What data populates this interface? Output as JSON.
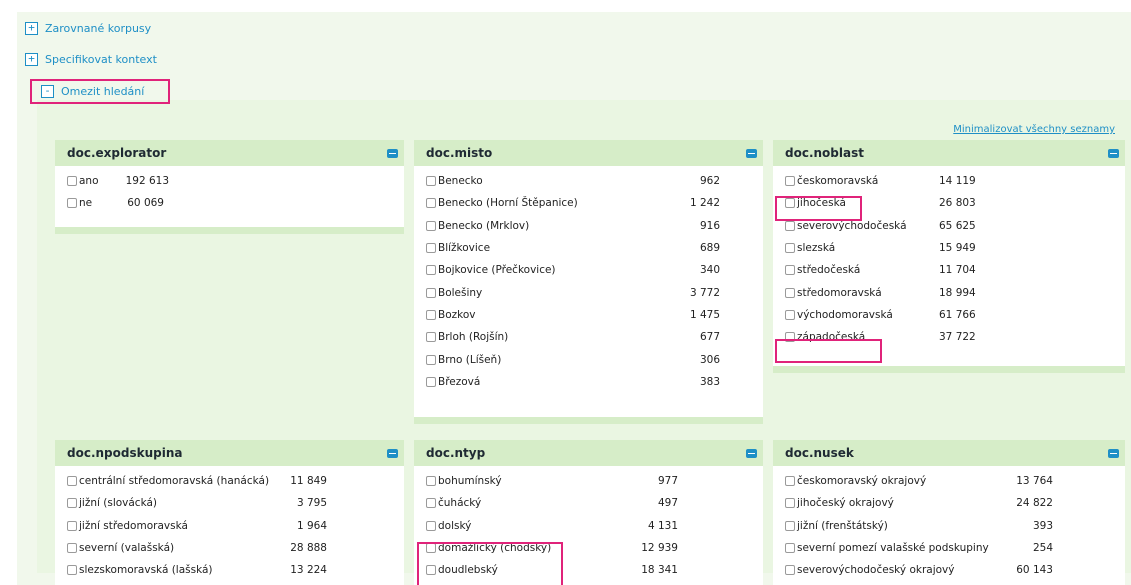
{
  "toggles": [
    {
      "symbol": "+",
      "label": "Zarovnané korpusy"
    },
    {
      "symbol": "+",
      "label": "Specifikovat kontext"
    },
    {
      "symbol": "-",
      "label": "Omezit hledání"
    }
  ],
  "minimize_all_label": "Minimalizovat všechny seznamy",
  "panels": [
    {
      "title": "doc.explorator",
      "items": [
        {
          "label": "ano",
          "count": "192 613"
        },
        {
          "label": "ne",
          "count": "60 069"
        }
      ]
    },
    {
      "title": "doc.misto",
      "items": [
        {
          "label": "Benecko",
          "count": "962"
        },
        {
          "label": "Benecko (Horní Štěpanice)",
          "count": "1 242"
        },
        {
          "label": "Benecko (Mrklov)",
          "count": "916"
        },
        {
          "label": "Blížkovice",
          "count": "689"
        },
        {
          "label": "Bojkovice (Přečkovice)",
          "count": "340"
        },
        {
          "label": "Bolešiny",
          "count": "3 772"
        },
        {
          "label": "Bozkov",
          "count": "1 475"
        },
        {
          "label": "Brloh (Rojšín)",
          "count": "677"
        },
        {
          "label": "Brno (Líšeň)",
          "count": "306"
        },
        {
          "label": "Březová",
          "count": "383"
        }
      ]
    },
    {
      "title": "doc.noblast",
      "items": [
        {
          "label": "českomoravská",
          "count": "14 119"
        },
        {
          "label": "jihočeská",
          "count": "26 803"
        },
        {
          "label": "severovýchodočeská",
          "count": "65 625"
        },
        {
          "label": "slezská",
          "count": "15 949"
        },
        {
          "label": "středočeská",
          "count": "11 704"
        },
        {
          "label": "středomoravská",
          "count": "18 994"
        },
        {
          "label": "východomoravská",
          "count": "61 766"
        },
        {
          "label": "západočeská",
          "count": "37 722"
        }
      ]
    },
    {
      "title": "doc.npodskupina",
      "items": [
        {
          "label": "centrální středomoravská (hanácká)",
          "count": "11 849"
        },
        {
          "label": "jižní (slovácká)",
          "count": "3 795"
        },
        {
          "label": "jižní středomoravská",
          "count": "1 964"
        },
        {
          "label": "severní (valašská)",
          "count": "28 888"
        },
        {
          "label": "slezskomoravská (lašská)",
          "count": "13 224"
        }
      ]
    },
    {
      "title": "doc.ntyp",
      "items": [
        {
          "label": "bohumínský",
          "count": "977"
        },
        {
          "label": "čuhácký",
          "count": "497"
        },
        {
          "label": "dolský",
          "count": "4 131"
        },
        {
          "label": "domažlický (chodský)",
          "count": "12 939"
        },
        {
          "label": "doudlebský",
          "count": "18 341"
        }
      ]
    },
    {
      "title": "doc.nusek",
      "items": [
        {
          "label": "českomoravský okrajový",
          "count": "13 764"
        },
        {
          "label": "jihočeský okrajový",
          "count": "24 822"
        },
        {
          "label": "jižní (frenštátský)",
          "count": "393"
        },
        {
          "label": "severní pomezí valašské podskupiny",
          "count": "254"
        },
        {
          "label": "severovýchodočeský okrajový",
          "count": "60 143"
        }
      ]
    }
  ]
}
